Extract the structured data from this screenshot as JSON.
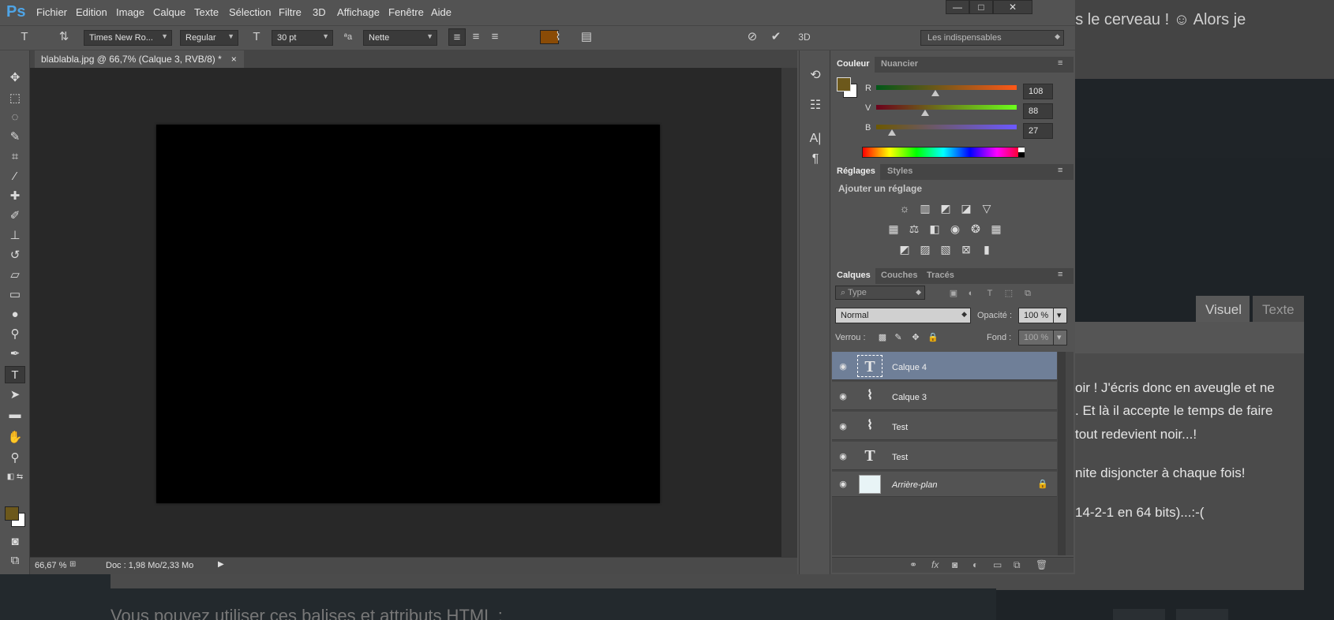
{
  "background_page": {
    "top_text": "mais le cerveau ! ☺ Alors je",
    "tab_visuel": "Visuel",
    "tab_texte": "Texte",
    "lines": [
      "oir ! J'écris donc en aveugle  et ne",
      ". Et là il accepte le temps de faire",
      " tout redevient noir...!",
      "nite disjoncter à chaque fois!",
      " 14-2-1 en 64 bits)...:-("
    ],
    "footer_text": "Vous pouvez utiliser ces balises et attributs HTML :"
  },
  "menubar": {
    "logo": "Ps",
    "items": [
      "Fichier",
      "Edition",
      "Image",
      "Calque",
      "Texte",
      "Sélection",
      "Filtre",
      "3D",
      "Affichage",
      "Fenêtre",
      "Aide"
    ],
    "minimize": "—",
    "maximize": "□",
    "close": "✕"
  },
  "options": {
    "font_family": "Times New Ro...",
    "font_style": "Regular",
    "font_size": "30 pt",
    "antialias_icon": "ᵃa",
    "antialias": "Nette",
    "text_color": "#8a4b06",
    "threed": "3D",
    "workspace": "Les indispensables"
  },
  "document": {
    "tab_title": "blablabla.jpg @ 66,7% (Calque 3, RVB/8) *",
    "tab_close": "×",
    "zoom": "66,67 %",
    "doc_info": "Doc : 1,98 Mo/2,33 Mo"
  },
  "color_panel": {
    "tab_couleur": "Couleur",
    "tab_nuancier": "Nuancier",
    "foreground_color": "#6c581b",
    "r_label": "R",
    "v_label": "V",
    "b_label": "B",
    "r": "108",
    "v": "88",
    "b": "27",
    "r_fraction": 0.42,
    "v_fraction": 0.35,
    "b_fraction": 0.11
  },
  "adjustments_panel": {
    "tab_reglages": "Réglages",
    "tab_styles": "Styles",
    "heading": "Ajouter un réglage"
  },
  "layers_panel": {
    "tab_calques": "Calques",
    "tab_couches": "Couches",
    "tab_traces": "Tracés",
    "filter_type": "⌕ Type",
    "blend_mode": "Normal",
    "opacity_label": "Opacité :",
    "opacity": "100 %",
    "lock_label": "Verrou :",
    "fill_label": "Fond :",
    "fill": "100 %",
    "layers": [
      {
        "name": "Calque 4",
        "kind": "text",
        "selected": true
      },
      {
        "name": "Calque 3",
        "kind": "warp-text",
        "selected": false
      },
      {
        "name": "Test",
        "kind": "warp-text",
        "selected": false
      },
      {
        "name": "Test",
        "kind": "text",
        "selected": false
      },
      {
        "name": "Arrière-plan",
        "kind": "image",
        "selected": false
      }
    ]
  }
}
